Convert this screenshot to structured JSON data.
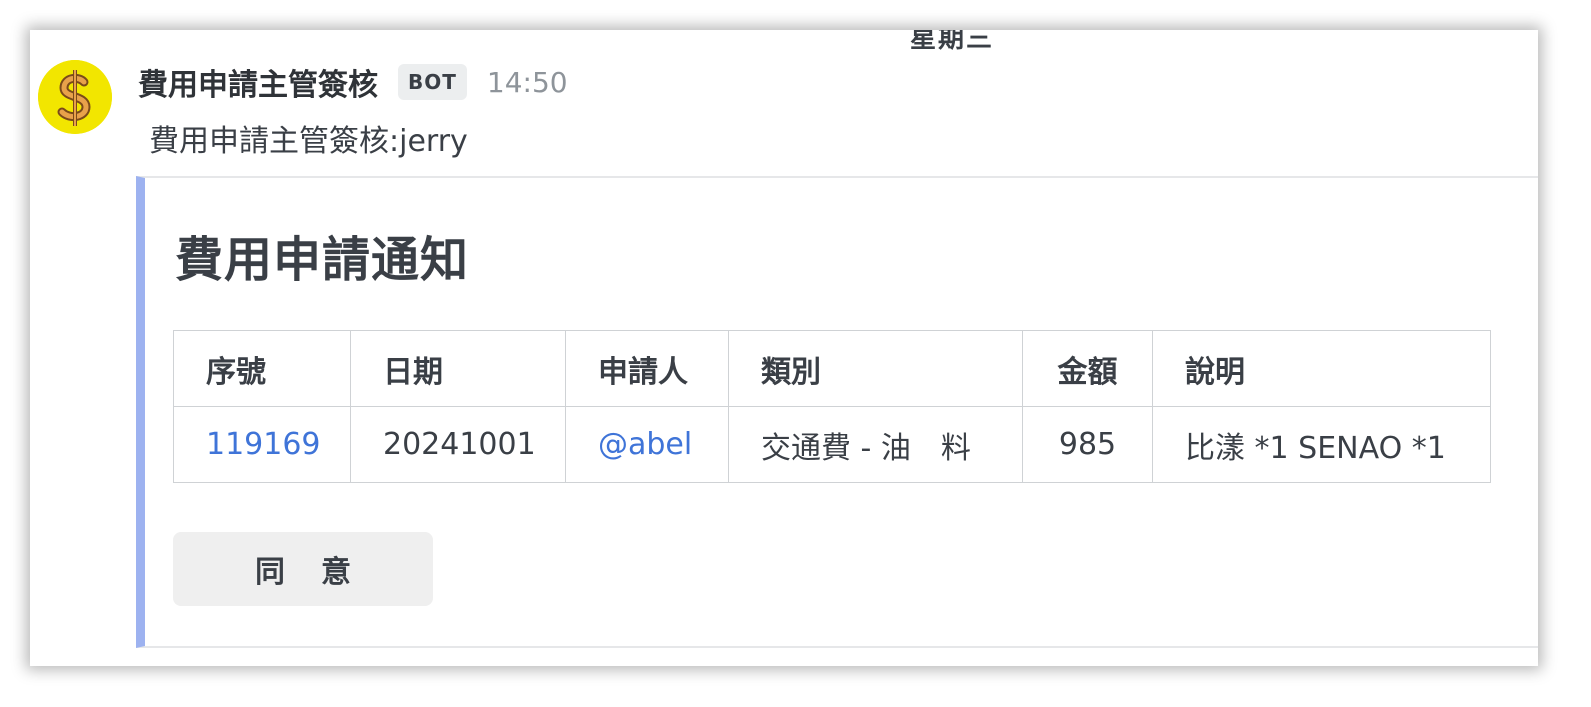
{
  "date_divider": "星期三",
  "message": {
    "sender": "費用申請主管簽核",
    "badge": "BOT",
    "time": "14:50",
    "text": "費用申請主管簽核:jerry"
  },
  "attachment": {
    "title": "費用申請通知",
    "table": {
      "headers": [
        "序號",
        "日期",
        "申請人",
        "類別",
        "金額",
        "說明"
      ],
      "rows": [
        [
          "119169",
          "20241001",
          "@abel",
          "交通費 - 油　料",
          "985",
          "比漾 *1 SENAO *1"
        ]
      ]
    },
    "button_label": "同意"
  },
  "colors": {
    "accent_bar": "#9db2f0",
    "link": "#3f74d8",
    "avatar_bg": "#f2e600"
  }
}
